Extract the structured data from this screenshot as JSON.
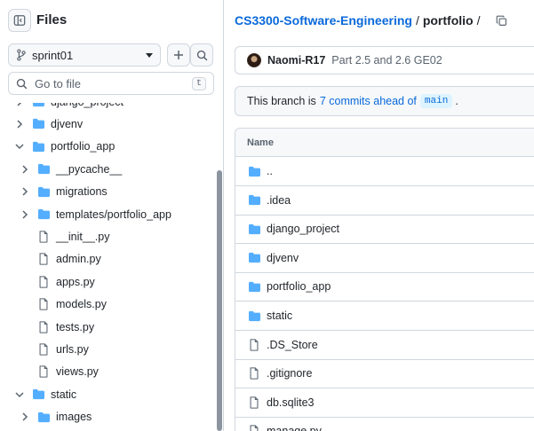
{
  "sidebar": {
    "title": "Files",
    "branch": "sprint01",
    "goto_placeholder": "Go to file",
    "goto_shortcut": "t",
    "tree": [
      {
        "label": "django_project",
        "type": "folder",
        "depth": 0,
        "expanded": false,
        "partial": true
      },
      {
        "label": "djvenv",
        "type": "folder",
        "depth": 0,
        "expanded": false
      },
      {
        "label": "portfolio_app",
        "type": "folder",
        "depth": 0,
        "expanded": true
      },
      {
        "label": "__pycache__",
        "type": "folder",
        "depth": 1,
        "expanded": false
      },
      {
        "label": "migrations",
        "type": "folder",
        "depth": 1,
        "expanded": false
      },
      {
        "label": "templates/portfolio_app",
        "type": "folder",
        "depth": 1,
        "expanded": false
      },
      {
        "label": "__init__.py",
        "type": "file",
        "depth": 1
      },
      {
        "label": "admin.py",
        "type": "file",
        "depth": 1
      },
      {
        "label": "apps.py",
        "type": "file",
        "depth": 1
      },
      {
        "label": "models.py",
        "type": "file",
        "depth": 1
      },
      {
        "label": "tests.py",
        "type": "file",
        "depth": 1
      },
      {
        "label": "urls.py",
        "type": "file",
        "depth": 1
      },
      {
        "label": "views.py",
        "type": "file",
        "depth": 1
      },
      {
        "label": "static",
        "type": "folder",
        "depth": 0,
        "expanded": true
      },
      {
        "label": "images",
        "type": "folder",
        "depth": 1,
        "expanded": false
      }
    ]
  },
  "main": {
    "breadcrumb": {
      "repo": "CS3300-Software-Engineering",
      "current": "portfolio"
    },
    "commit": {
      "author": "Naomi-R17",
      "message": "Part 2.5 and 2.6 GE02"
    },
    "ahead": {
      "prefix": "This branch is",
      "link": "7 commits ahead of",
      "base": "main",
      "suffix": "."
    },
    "table": {
      "header": "Name",
      "rows": [
        {
          "name": "..",
          "type": "folder"
        },
        {
          "name": ".idea",
          "type": "folder"
        },
        {
          "name": "django_project",
          "type": "folder"
        },
        {
          "name": "djvenv",
          "type": "folder"
        },
        {
          "name": "portfolio_app",
          "type": "folder"
        },
        {
          "name": "static",
          "type": "folder"
        },
        {
          "name": ".DS_Store",
          "type": "file"
        },
        {
          "name": ".gitignore",
          "type": "file"
        },
        {
          "name": "db.sqlite3",
          "type": "file"
        },
        {
          "name": "manage.py",
          "type": "file"
        }
      ]
    }
  },
  "colors": {
    "accent": "#0969da",
    "folder": "#54aeff",
    "border": "#d0d7de"
  }
}
